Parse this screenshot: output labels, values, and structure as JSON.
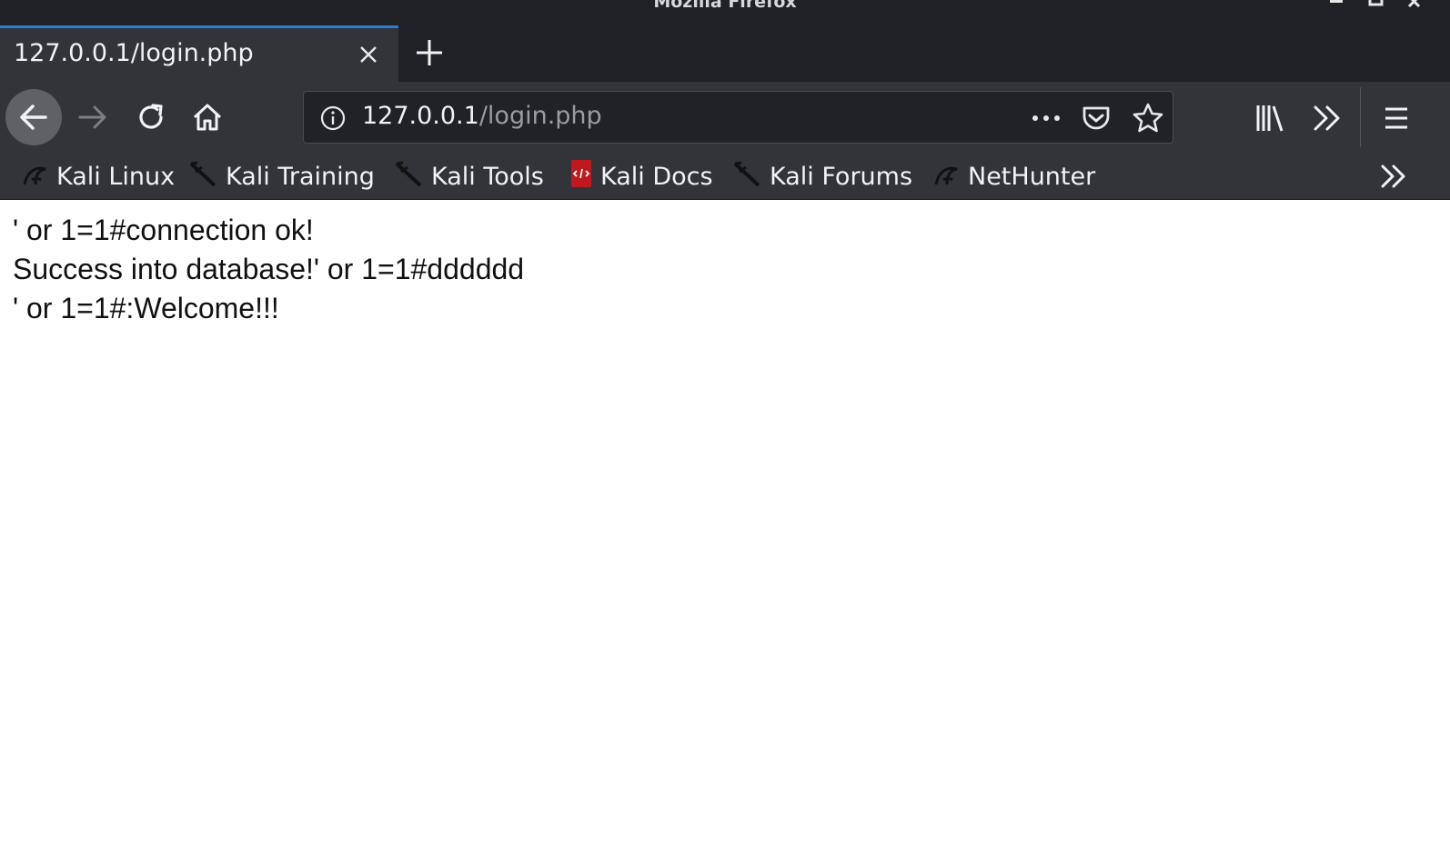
{
  "window": {
    "title": "Mozilla Firefox",
    "minimize_icon": "minimize-icon",
    "maximize_icon": "maximize-icon",
    "close_icon": "close-icon"
  },
  "tab": {
    "title": "127.0.0.1/login.php",
    "close_icon": "close-icon",
    "new_tab_icon": "plus-icon"
  },
  "navbar": {
    "url_host": "127.0.0.1",
    "url_path": "/login.php",
    "icons": [
      "arrow-left-icon",
      "arrow-right-icon",
      "reload-icon",
      "home-icon",
      "info-icon",
      "more-icon",
      "pocket-icon",
      "star-icon",
      "library-icon",
      "overflow-icon",
      "menu-icon"
    ]
  },
  "bookmarks": {
    "items": [
      {
        "label": "Kali Linux",
        "icon": "kali-dragon-icon"
      },
      {
        "label": "Kali Training",
        "icon": "kali-sword-icon"
      },
      {
        "label": "Kali Tools",
        "icon": "kali-sword-icon"
      },
      {
        "label": "Kali Docs",
        "icon": "kali-docs-icon"
      },
      {
        "label": "Kali Forums",
        "icon": "kali-sword-icon"
      },
      {
        "label": "NetHunter",
        "icon": "kali-dragon-icon"
      }
    ],
    "overflow_icon": "chevron-double-right-icon"
  },
  "page": {
    "lines": [
      "' or 1=1#connection ok!",
      "Success into database!' or 1=1#dddddd",
      "' or 1=1#:Welcome!!!"
    ]
  },
  "colors": {
    "chrome_dark": "#1f2126",
    "toolbar": "#32343a",
    "tab_accent": "#2e7bd8",
    "urlbar": "#202226",
    "page_bg": "#ffffff"
  }
}
